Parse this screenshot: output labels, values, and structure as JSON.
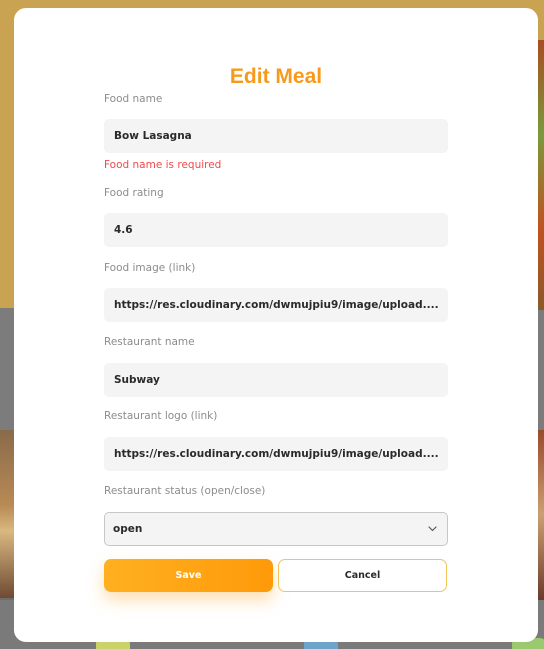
{
  "modal": {
    "title": "Edit Meal",
    "fields": [
      {
        "label": "Food name",
        "value": "Bow Lasagna",
        "error": "Food name is required"
      },
      {
        "label": "Food rating",
        "value": "4.6"
      },
      {
        "label": "Food image (link)",
        "value": "https://res.cloudinary.com/dwmujpiu9/image/upload......."
      },
      {
        "label": "Restaurant name",
        "value": "Subway"
      },
      {
        "label": "Restaurant logo (link)",
        "value": "https://res.cloudinary.com/dwmujpiu9/image/upload......."
      }
    ],
    "status": {
      "label": "Restaurant status (open/close)",
      "selected": "open"
    },
    "buttons": {
      "save": "Save",
      "cancel": "Cancel"
    }
  },
  "colors": {
    "accent": "#f79a1c",
    "error": "#ef4a4a",
    "button_gradient_start": "#ffb020",
    "button_gradient_end": "#ff9a0a"
  },
  "icons": {
    "select_chevron": "chevron-down-icon"
  }
}
